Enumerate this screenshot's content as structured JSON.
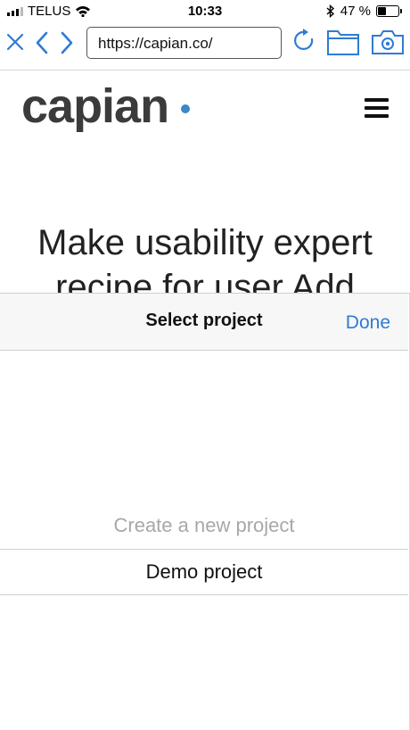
{
  "status_bar": {
    "carrier": "TELUS",
    "time": "10:33",
    "battery_percent": "47 %",
    "battery_level": 0.47,
    "icons": [
      "signal-icon",
      "wifi-icon",
      "bluetooth-icon",
      "battery-icon"
    ]
  },
  "browser": {
    "url": "https://capian.co/",
    "icons": [
      "close-icon",
      "back-icon",
      "forward-icon",
      "reload-icon",
      "folder-icon",
      "camera-icon"
    ],
    "accent_color": "#2f7bd4"
  },
  "site": {
    "logo_text": "capian",
    "logo_dot_color": "#3a88c8",
    "headline": "Make usability expert",
    "headline_partial": "recipe  for  user  Add"
  },
  "picker": {
    "title": "Select project",
    "done_label": "Done",
    "options": [
      "Create a new project",
      "Demo project"
    ],
    "selected": "Demo project"
  }
}
